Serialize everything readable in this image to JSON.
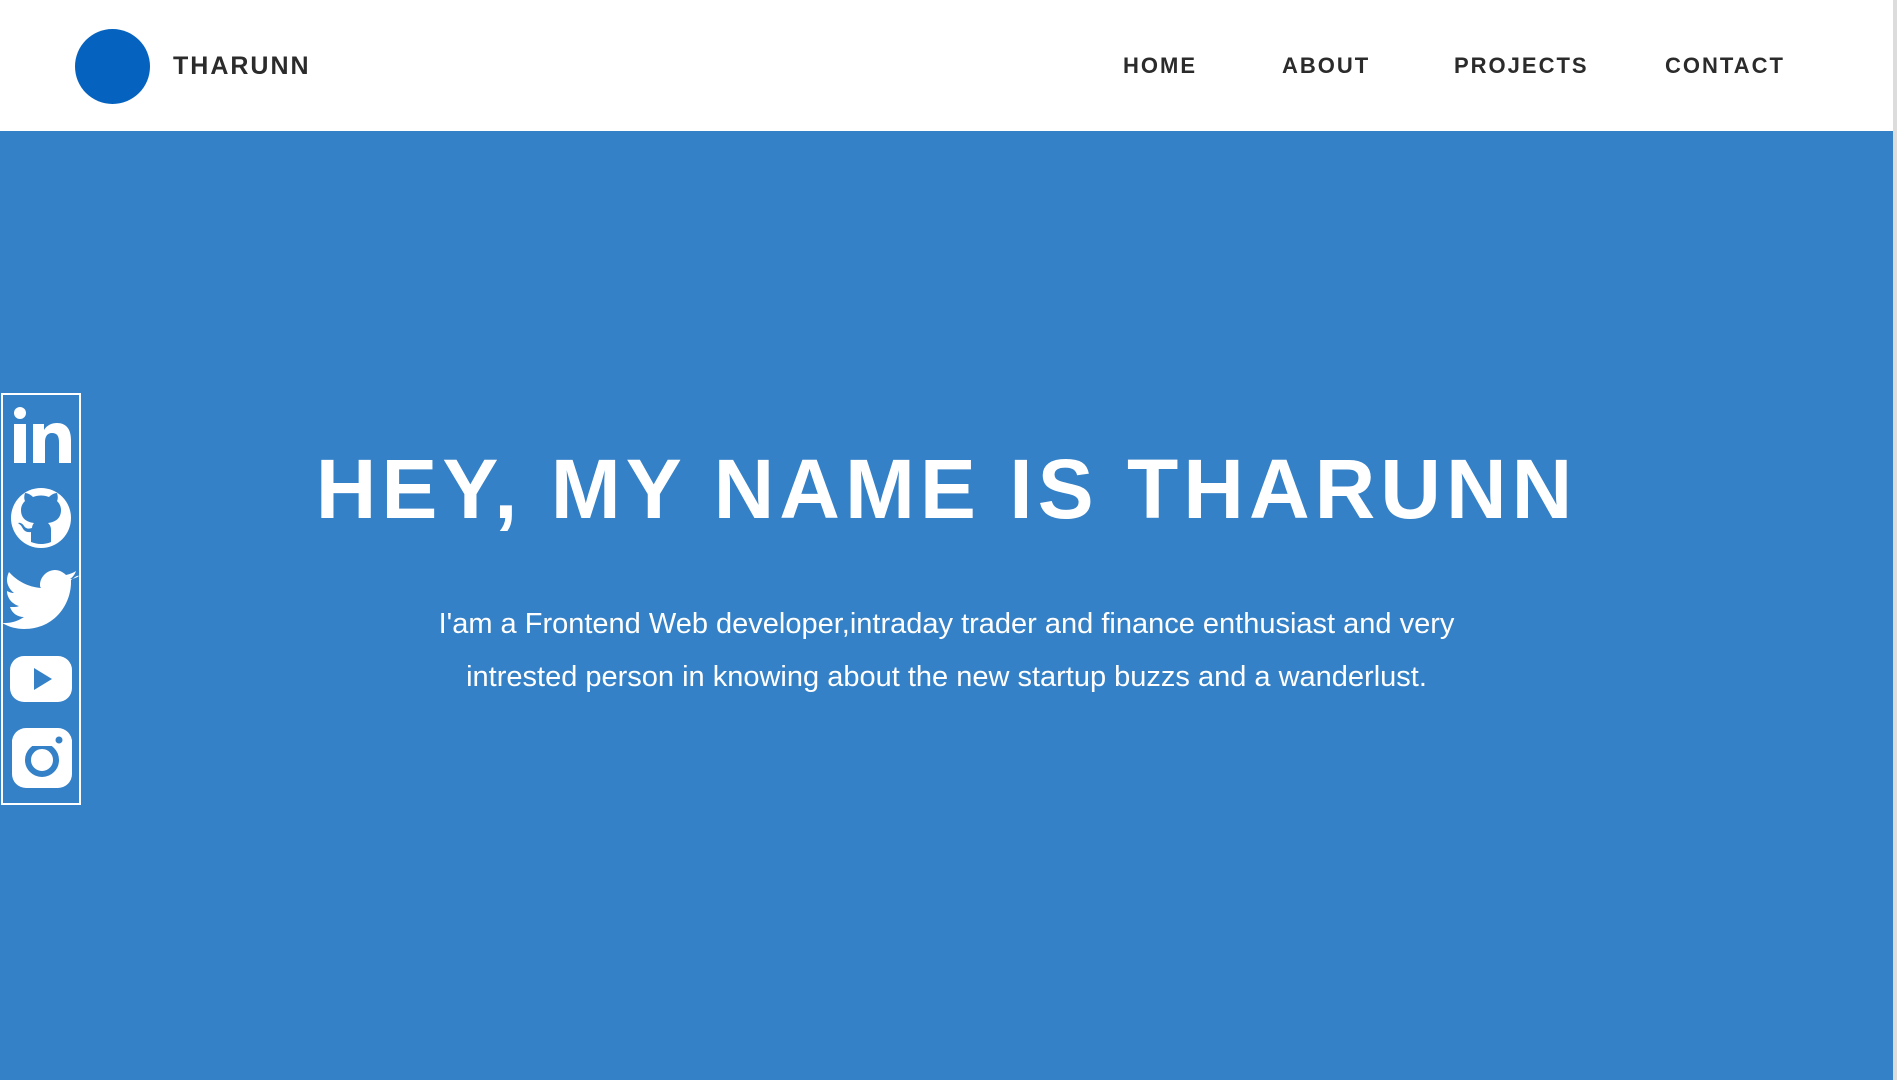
{
  "header": {
    "brand": "THARUNN",
    "nav": {
      "home": "HOME",
      "about": "ABOUT",
      "projects": "PROJECTS",
      "contact": "CONTACT"
    }
  },
  "hero": {
    "title": "HEY, MY NAME IS THARUNN",
    "description": "I'am a Frontend Web developer,intraday trader and finance enthusiast and very intrested person in knowing about the new startup buzzs and a wanderlust."
  },
  "social": {
    "icons": [
      "linkedin-icon",
      "github-icon",
      "twitter-icon",
      "youtube-icon",
      "instagram-icon"
    ]
  },
  "colors": {
    "hero_background": "#3481c7",
    "logo": "#0563bf",
    "nav_text": "#2b2b2b",
    "header_background": "#ffffff",
    "icon_color": "#ffffff"
  }
}
